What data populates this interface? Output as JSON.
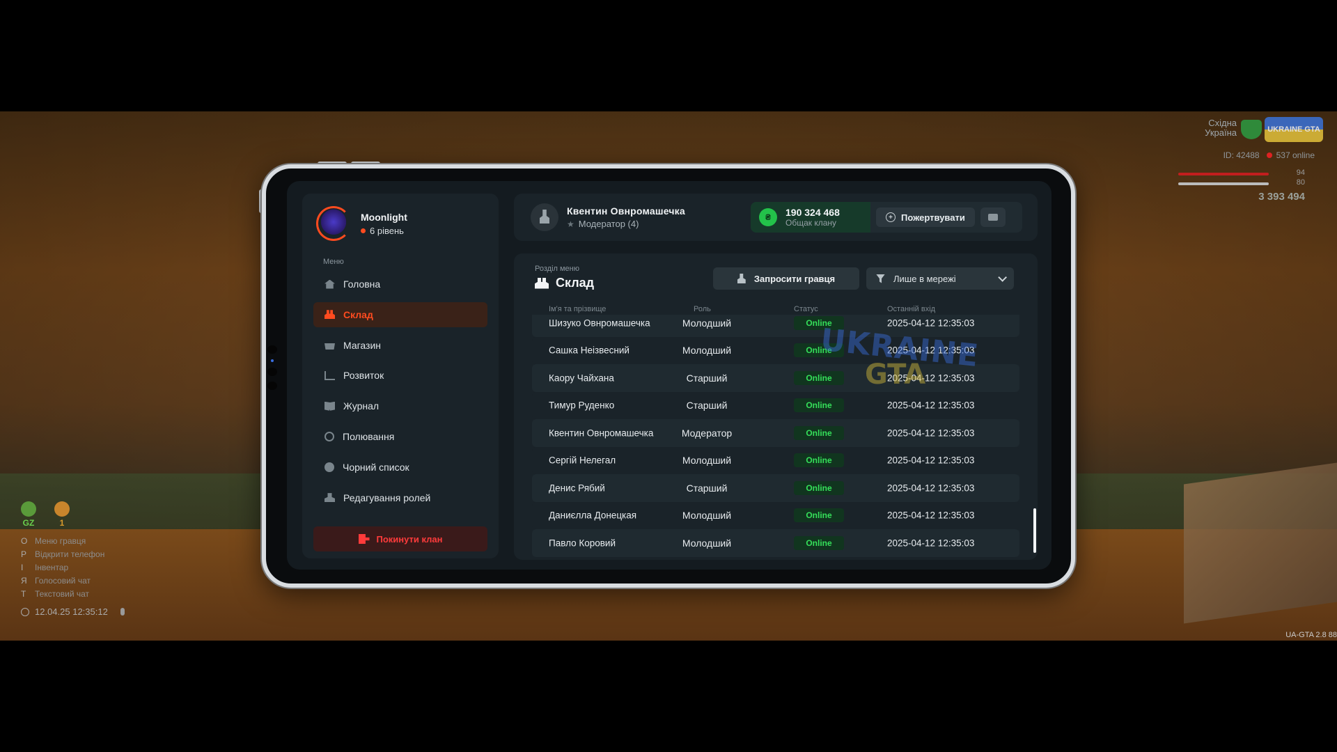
{
  "hud": {
    "region": [
      "Східна",
      "Україна"
    ],
    "logo_text": "UKRAINE GTA",
    "player_id": "ID: 42488",
    "online": "537 online",
    "health_value": "94",
    "armor_value": "80",
    "money": "3 393 494",
    "gz_label": "GZ",
    "gz2_value": "1",
    "keys": [
      {
        "key": "O",
        "label": "Меню гравця"
      },
      {
        "key": "P",
        "label": "Відкрити телефон"
      },
      {
        "key": "I",
        "label": "Інвентар"
      },
      {
        "key": "Я",
        "label": "Голосовий чат"
      },
      {
        "key": "T",
        "label": "Текстовий чат"
      }
    ],
    "datetime": "12.04.25 12:35:12",
    "version": "UA-GTA 2.8   88"
  },
  "sidebar": {
    "profile_name": "Moonlight",
    "profile_level": "6 рівень",
    "menu_caption": "Меню",
    "items": [
      {
        "label": "Головна",
        "icon": "home-icon"
      },
      {
        "label": "Склад",
        "icon": "people-icon",
        "active": true
      },
      {
        "label": "Магазин",
        "icon": "shop-icon"
      },
      {
        "label": "Розвиток",
        "icon": "chart-icon"
      },
      {
        "label": "Журнал",
        "icon": "book-icon"
      },
      {
        "label": "Полювання",
        "icon": "target-icon"
      },
      {
        "label": "Чорний список",
        "icon": "block-icon"
      },
      {
        "label": "Редагування ролей",
        "icon": "user-edit-icon"
      }
    ],
    "leave_label": "Покинути клан"
  },
  "header": {
    "user_name": "Квентин Овнромашечка",
    "user_role": "Модератор (4)",
    "balance_value": "190 324 468",
    "balance_label": "Общак клану",
    "donate_label": "Пожертвувати"
  },
  "main": {
    "section_caption": "Розділ меню",
    "section_title": "Склад",
    "invite_label": "Запросити гравця",
    "filter_value": "Лише в мережі",
    "columns": [
      "Ім'я та прізвище",
      "Роль",
      "Статус",
      "Останній вхід"
    ],
    "rows": [
      {
        "name": "Шизуко Овнромашечка",
        "role": "Молодший",
        "status": "Online",
        "last": "2025-04-12 12:35:03"
      },
      {
        "name": "Сашка Неізвесний",
        "role": "Молодший",
        "status": "Online",
        "last": "2025-04-12 12:35:03"
      },
      {
        "name": "Каору Чайхана",
        "role": "Старший",
        "status": "Online",
        "last": "2025-04-12 12:35:03"
      },
      {
        "name": "Тимур Руденко",
        "role": "Старший",
        "status": "Online",
        "last": "2025-04-12 12:35:03"
      },
      {
        "name": "Квентин Овнромашечка",
        "role": "Модератор",
        "status": "Online",
        "last": "2025-04-12 12:35:03"
      },
      {
        "name": "Сергій Нелегал",
        "role": "Молодший",
        "status": "Online",
        "last": "2025-04-12 12:35:03"
      },
      {
        "name": "Денис Рябий",
        "role": "Старший",
        "status": "Online",
        "last": "2025-04-12 12:35:03"
      },
      {
        "name": "Даниєлла Донецкая",
        "role": "Молодший",
        "status": "Online",
        "last": "2025-04-12 12:35:03"
      },
      {
        "name": "Павло Коровий",
        "role": "Молодший",
        "status": "Online",
        "last": "2025-04-12 12:35:03"
      }
    ],
    "watermark": [
      "UKRAINE",
      "GTA"
    ]
  },
  "colors": {
    "accent": "#ff4b1f",
    "online": "#35e05a",
    "danger": "#ff3b3b",
    "panel": "#1a2329"
  }
}
